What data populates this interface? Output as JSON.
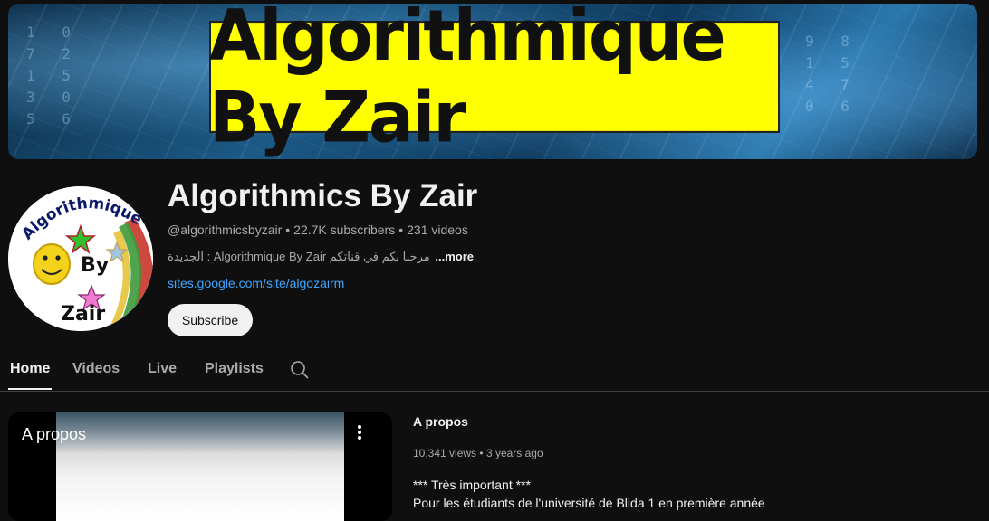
{
  "banner": {
    "title": "Algorithmique By Zair"
  },
  "avatar": {
    "text_top": "Algorithmique",
    "text_mid": "By",
    "text_bottom": "Zair"
  },
  "channel": {
    "name": "Algorithmics By Zair",
    "handle": "@algorithmicsbyzair",
    "separator": "•",
    "subscribers": "22.7K subscribers",
    "videos": "231 videos",
    "description": "مرحبا بكم في قناتكم Algorithmique By Zair : الجديدة",
    "more_label": "...more",
    "link": "sites.google.com/site/algozairm",
    "subscribe_label": "Subscribe"
  },
  "tabs": [
    {
      "label": "Home"
    },
    {
      "label": "Videos"
    },
    {
      "label": "Live"
    },
    {
      "label": "Playlists"
    }
  ],
  "featured": {
    "player_title": "A propos",
    "title": "A propos",
    "views": "10,341 views",
    "separator": "•",
    "age": "3 years ago",
    "desc_line1": "*** Très important ***",
    "desc_line2": "Pour les étudiants de l'université de Blida 1 en première année"
  },
  "colors": {
    "background": "#0f0f0f",
    "link": "#3ea6ff",
    "banner_title_bg": "#ffff00"
  },
  "icons": {
    "search_tab": "search-icon",
    "video_menu": "more-vert-icon"
  }
}
